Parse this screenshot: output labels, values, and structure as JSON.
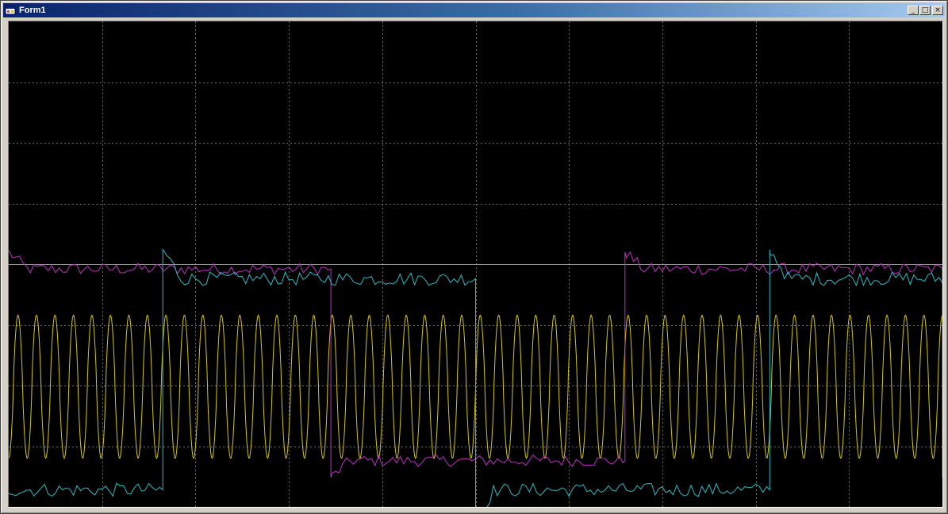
{
  "window": {
    "title": "Form1",
    "buttons": {
      "minimize": "_",
      "maximize": "□",
      "close": "×"
    }
  },
  "colors": {
    "background": "#000000",
    "grid": "#6e6e6e",
    "grid_solid": "#9a9a9a",
    "yellow": "#d6c800",
    "magenta": "#c02cc6",
    "cyan": "#23bcc4"
  },
  "chart_data": {
    "type": "line",
    "title": "",
    "xlabel": "",
    "ylabel": "",
    "grid": true,
    "x_range": [
      0,
      1
    ],
    "y_range": [
      0,
      1
    ],
    "series": [
      {
        "color": "yellow",
        "kind": "sine",
        "cycles": 50.5,
        "low": 0.1,
        "high": 0.395
      },
      {
        "color": "magenta",
        "kind": "square",
        "transitions": [
          0.0,
          0.345,
          0.66,
          1.0
        ],
        "high": 0.49,
        "low": 0.095,
        "noise": 0.012,
        "overshoot": 0.035
      },
      {
        "color": "cyan",
        "kind": "square",
        "transitions": [
          0.165,
          0.5,
          0.815
        ],
        "high": 0.47,
        "low": 0.035,
        "noise": 0.014,
        "overshoot": 0.06
      }
    ]
  }
}
